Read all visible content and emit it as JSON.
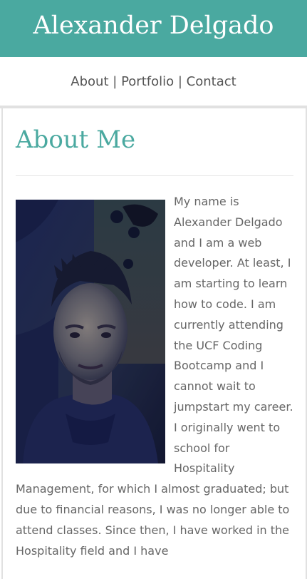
{
  "header": {
    "title": "Alexander Delgado",
    "background_color": "#4aa9a0"
  },
  "nav": {
    "items": [
      {
        "label": "About"
      },
      {
        "label": "Portfolio"
      },
      {
        "label": "Contact"
      }
    ],
    "separator": "|"
  },
  "about": {
    "heading": "About Me",
    "accent_color": "#4aa9a0",
    "photo_description": "profile-photo",
    "paragraph": "My name is Alexander Delgado and I am a web developer. At least, I am starting to learn how to code. I am currently attending the UCF Coding Bootcamp and I cannot wait to jumpstart my career. I originally went to school for Hospitality Management, for which I almost graduated; but due to financial reasons, I was no longer able to attend classes. Since then, I have worked in the Hospitality field and I have"
  }
}
